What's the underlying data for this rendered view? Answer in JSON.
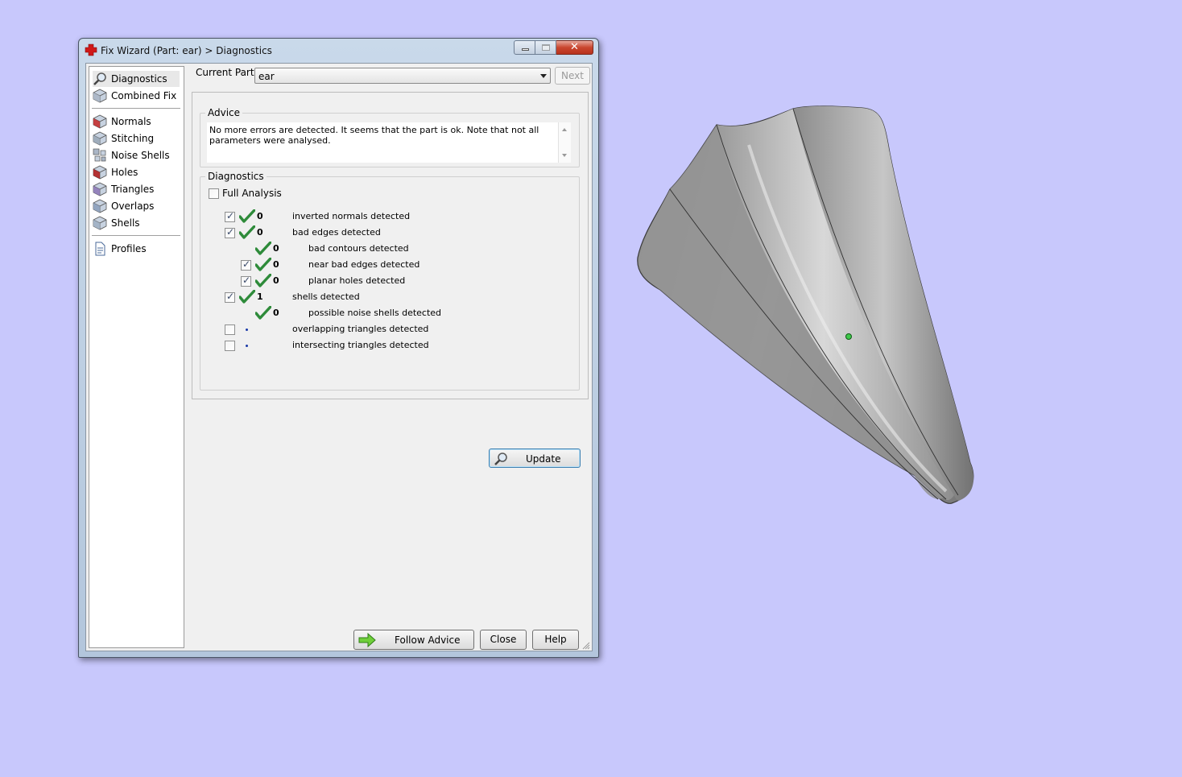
{
  "window": {
    "title": "Fix Wizard (Part: ear) > Diagnostics",
    "close_glyph": "✕"
  },
  "sidebar": {
    "groups": [
      [
        {
          "label": "Diagnostics",
          "icon": "magnifier-icon",
          "selected": true
        },
        {
          "label": "Combined Fix",
          "icon": "cube-icon"
        }
      ],
      [
        {
          "label": "Normals",
          "icon": "normals-cube-icon"
        },
        {
          "label": "Stitching",
          "icon": "stitching-cube-icon"
        },
        {
          "label": "Noise Shells",
          "icon": "noise-shells-icon"
        },
        {
          "label": "Holes",
          "icon": "holes-cube-icon"
        },
        {
          "label": "Triangles",
          "icon": "triangles-cube-icon"
        },
        {
          "label": "Overlaps",
          "icon": "overlaps-cube-icon"
        },
        {
          "label": "Shells",
          "icon": "shells-cube-icon"
        }
      ],
      [
        {
          "label": "Profiles",
          "icon": "document-icon"
        }
      ]
    ]
  },
  "header": {
    "current_part_label": "Current Part:",
    "current_part_value": "ear",
    "next_label": "Next"
  },
  "advice": {
    "title": "Advice",
    "text": "No more errors are detected. It seems that the part is ok. Note that not all parameters were analysed."
  },
  "diagnostics": {
    "title": "Diagnostics",
    "full_analysis_label": "Full Analysis",
    "full_analysis_checked": false,
    "rows": [
      {
        "checkbox": true,
        "checked": true,
        "status": "ok",
        "count": "0",
        "label": "inverted normals detected",
        "indent": 0
      },
      {
        "checkbox": true,
        "checked": true,
        "status": "ok",
        "count": "0",
        "label": "bad edges detected",
        "indent": 0
      },
      {
        "checkbox": false,
        "checked": false,
        "status": "ok",
        "count": "0",
        "label": "bad contours detected",
        "indent": 1
      },
      {
        "checkbox": true,
        "checked": true,
        "status": "ok",
        "count": "0",
        "label": "near bad edges detected",
        "indent": 1
      },
      {
        "checkbox": true,
        "checked": true,
        "status": "ok",
        "count": "0",
        "label": "planar holes detected",
        "indent": 1
      },
      {
        "checkbox": true,
        "checked": true,
        "status": "ok",
        "count": "1",
        "label": "shells detected",
        "indent": 0
      },
      {
        "checkbox": false,
        "checked": false,
        "status": "ok",
        "count": "0",
        "label": "possible noise shells detected",
        "indent": 1
      },
      {
        "checkbox": true,
        "checked": false,
        "status": "pending",
        "count": "",
        "label": "overlapping triangles detected",
        "indent": 0
      },
      {
        "checkbox": true,
        "checked": false,
        "status": "pending",
        "count": "",
        "label": "intersecting triangles detected",
        "indent": 0
      }
    ],
    "update_label": "Update"
  },
  "footer": {
    "follow_advice_label": "Follow Advice",
    "close_label": "Close",
    "help_label": "Help"
  },
  "colors": {
    "desktop": "#c8c8fc",
    "ok_tick": "#2e8b3a",
    "pending_dot": "#1a3aa8",
    "model_gray": "#8c8c8c"
  }
}
